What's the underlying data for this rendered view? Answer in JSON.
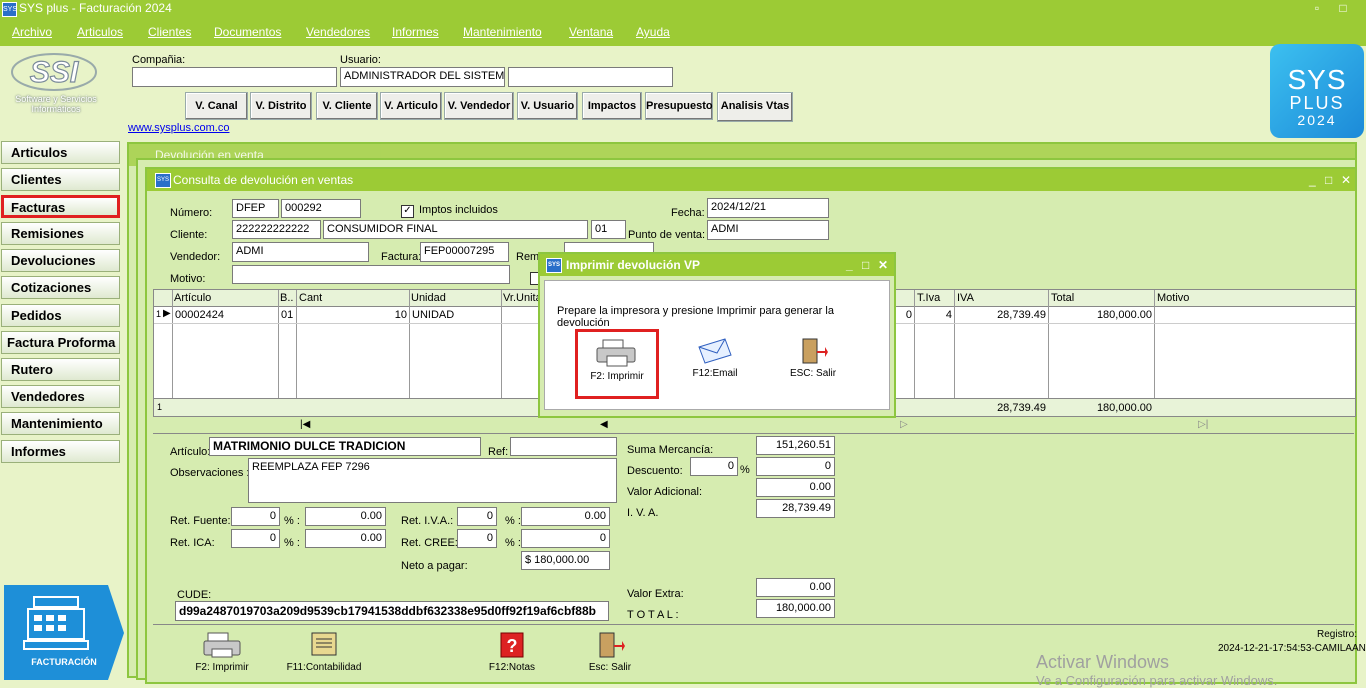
{
  "app": {
    "title": "SYS plus - Facturación 2024",
    "icon": "sys-icon"
  },
  "menu": [
    "Archivo",
    "Articulos",
    "Clientes",
    "Documentos",
    "Vendedores",
    "Informes",
    "Mantenimiento",
    "Ventana",
    "Ayuda"
  ],
  "logo": {
    "brand": "SSI",
    "caption_line1": "Software y Servicios",
    "caption_line2": "Informáticos"
  },
  "header": {
    "company_label": "Compañia:",
    "company_value": "",
    "user_label": "Usuario:",
    "user_value": "ADMINISTRADOR DEL SISTEM.",
    "user_extra": "",
    "website": "www.sysplus.com.co",
    "buttons": [
      "V. Canal",
      "V. Distrito",
      "V. Cliente",
      "V. Articulo",
      "V. Vendedor",
      "V. Usuario",
      "Impactos",
      "Presupuesto",
      "Analisis Vtas"
    ]
  },
  "badge": {
    "line1": "SYS",
    "line2": "PLUS",
    "year": "2024"
  },
  "nav": [
    "Articulos",
    "Clientes",
    "Facturas",
    "Remisiones",
    "Devoluciones",
    "Cotizaciones",
    "Pedidos",
    "Factura Proforma",
    "Rutero",
    "Vendedores",
    "Mantenimiento",
    "Informes"
  ],
  "nav_selected": "Facturas",
  "facturacion_tile": {
    "label": "FACTURACIÓN"
  },
  "bg_window": {
    "title": "Devolución en venta"
  },
  "main_window": {
    "title": "Consulta de devolución en ventas",
    "numero_label": "Número:",
    "numero_prefix": "DFEP",
    "numero_value": "000292",
    "iva_included_label": "Imptos incluidos",
    "iva_included_checked": true,
    "fecha_label": "Fecha:",
    "fecha_value": "2024/12/21",
    "cliente_label": "Cliente:",
    "cliente_id": "222222222222",
    "cliente_name": "CONSUMIDOR FINAL",
    "cliente_branch": "01",
    "punto_label": "Punto de venta:",
    "punto_value": "ADMI",
    "vendedor_label": "Vendedor:",
    "vendedor_value": "ADMI",
    "factura_label": "Factura:",
    "factura_value": "FEP00007295",
    "rem_label": "Rem",
    "motivo_label": "Motivo:",
    "motivo_value": "",
    "grid": {
      "columns": [
        "Artículo",
        "B..",
        "Cant",
        "Unidad",
        "Vr.Unita",
        "T.Iva",
        "IVA",
        "Total",
        "Motivo"
      ],
      "rows": [
        {
          "rownum": "1",
          "articulo": "00002424",
          "bodega": "01",
          "cant": "10",
          "unidad": "UNIDAD",
          "hidden_val": "0",
          "tiva": "4",
          "iva": "28,739.49",
          "total": "180,000.00",
          "motivo": ""
        }
      ],
      "footer": {
        "rownum": "1",
        "iva": "28,739.49",
        "total": "180,000.00"
      }
    },
    "articulo_label": "Artículo:",
    "articulo_value": "MATRIMONIO DULCE TRADICION",
    "ref_label": "Ref:",
    "ref_value": "",
    "obs_label": "Observaciones :",
    "obs_value": "REEMPLAZA FEP 7296",
    "suma_label": "Suma Mercancía:",
    "suma_value": "151,260.51",
    "descuento_label": "Descuento:",
    "descuento_pct": "0",
    "descuento_value": "0",
    "valor_adicional_label": "Valor Adicional:",
    "valor_adicional_value": "0.00",
    "iva_label": "I. V. A.",
    "iva_value": "28,739.49",
    "ret_fuente_label": "Ret. Fuente:",
    "ret_fuente_pct": "0",
    "ret_fuente_value": "0.00",
    "ret_iva_label": "Ret. I.V.A.:",
    "ret_iva_pct": "0",
    "ret_iva_value": "0.00",
    "ret_ica_label": "Ret. ICA:",
    "ret_ica_pct": "0",
    "ret_ica_value": "0.00",
    "ret_cree_label": "Ret. CREE:",
    "ret_cree_pct": "0",
    "ret_cree_value": "0",
    "pct_sign": "% :",
    "neto_label": "Neto a pagar:",
    "neto_value": "$ 180,000.00",
    "valor_extra_label": "Valor Extra:",
    "valor_extra_value": "0.00",
    "total_label": "T O T A L :",
    "total_value": "180,000.00",
    "cude_label": "CUDE:",
    "cude_value": "d99a2487019703a209d9539cb17941538ddbf632338e95d0ff92f19af6cbf88b",
    "toolbar": [
      "F2: Imprimir",
      "F11:Contabilidad",
      "F12:Notas",
      "Esc: Salir"
    ],
    "registro_label": "Registro:",
    "registro_value": "2024-12-21-17:54:53-CAMILAAN"
  },
  "dialog": {
    "title": "Imprimir devolución  VP",
    "message": "Prepare la impresora y presione Imprimir para generar la devolución",
    "buttons": [
      "F2: Imprimir",
      "F12:Email",
      "ESC: Salir"
    ]
  },
  "watermark": {
    "line1": "Activar Windows",
    "line2": "Ve a Configuración para activar Windows."
  },
  "colors": {
    "accent": "#9ccb35",
    "highlight": "#e02020",
    "panel": "#d6ecb0"
  }
}
